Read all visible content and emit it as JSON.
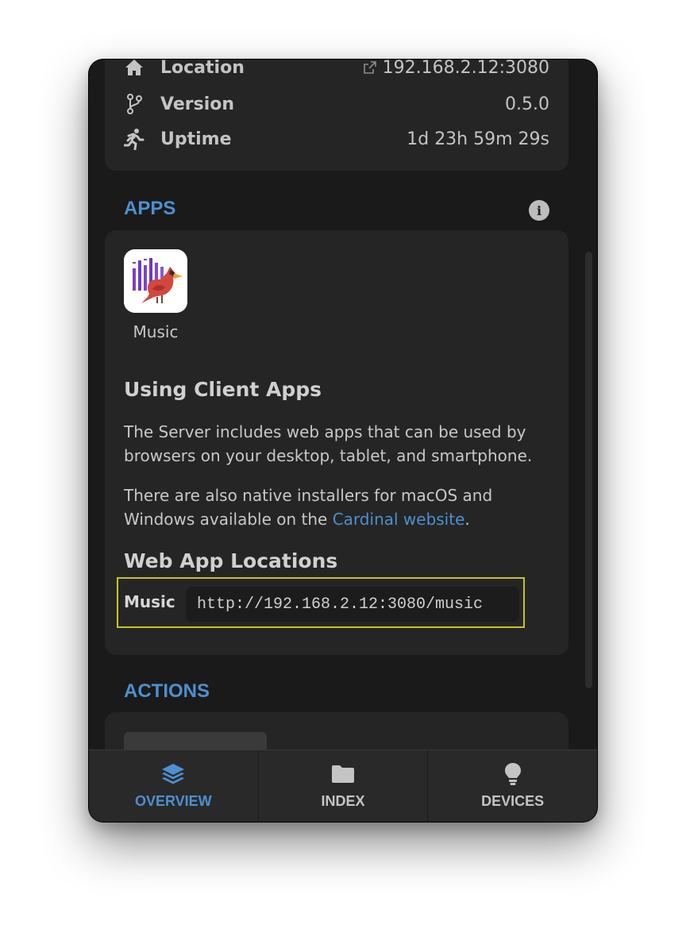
{
  "server_info": {
    "rows": [
      {
        "icon": "home-icon",
        "label": "Location",
        "value": "192.168.2.12:3080"
      },
      {
        "icon": "branch-icon",
        "label": "Version",
        "value": "0.5.0"
      },
      {
        "icon": "running-icon",
        "label": "Uptime",
        "value": "1d 23h 59m 29s"
      }
    ]
  },
  "apps_section": {
    "title": "APPS",
    "info_icon": "info-icon",
    "app": {
      "name": "Music",
      "icon": "cardinal-music-app-icon"
    },
    "using_heading": "Using Client Apps",
    "para1": "The Server includes web apps that can be used by browsers on your desktop, tablet, and smartphone.",
    "para2_prefix": "There are also native installers for macOS and Windows available on the ",
    "para2_link": "Cardinal website",
    "para2_suffix": ".",
    "locations_heading": "Web App Locations",
    "location": {
      "label": "Music",
      "url": "http://192.168.2.12:3080/music"
    }
  },
  "actions_section": {
    "title": "ACTIONS"
  },
  "tabs": [
    {
      "label": "OVERVIEW",
      "icon": "layers-icon",
      "active": true
    },
    {
      "label": "INDEX",
      "icon": "folder-icon",
      "active": false
    },
    {
      "label": "DEVICES",
      "icon": "lightbulb-icon",
      "active": false
    }
  ],
  "colors": {
    "accent": "#4d90cf",
    "window_bg": "#1a1a1a",
    "card_bg": "#252525",
    "highlight": "#c8c31d"
  }
}
